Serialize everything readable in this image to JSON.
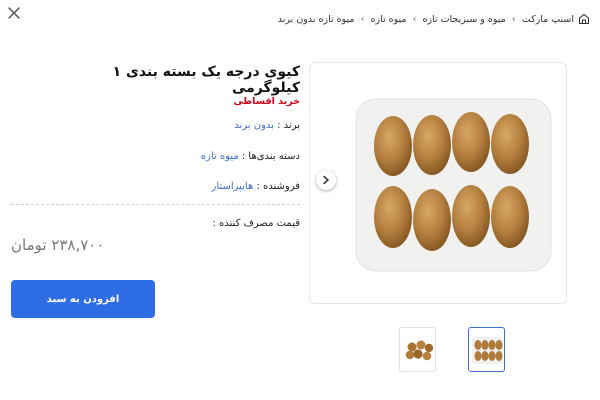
{
  "breadcrumb": [
    {
      "label": "اسنپ مارکت"
    },
    {
      "label": "میوه و سبزیجات تازه"
    },
    {
      "label": "میوه تازه"
    },
    {
      "label": "میوه تازه بدون برند"
    }
  ],
  "product": {
    "title": "کیوی درجه یک بسته بندی ۱ کیلوگرمی",
    "installment": "خرید اقساطی",
    "brand_label": "برند :",
    "brand_value": "بدون برند",
    "category_label": "دسته بندی‌ها :",
    "category_value": "میوه تازه",
    "seller_label": "فروشنده :",
    "seller_value": "هایپراستار",
    "price_label": "قیمت مصرف کننده :",
    "price": "۲۳۸,۷۰۰ تومان",
    "add_to_cart": "افزودن به سبد"
  },
  "colors": {
    "accent": "#2e6de6",
    "link": "#3d6fc9",
    "installment": "#d0021b",
    "price": "#777777"
  },
  "icons": {
    "close": "close-icon",
    "home": "store-icon",
    "breadcrumb_separator": "chevron-left-icon",
    "gallery_arrow": "chevron-right-icon"
  },
  "gallery": {
    "thumbnails": [
      {
        "name": "kiwi-tray-thumbnail",
        "selected": true
      },
      {
        "name": "kiwi-loose-thumbnail",
        "selected": false
      }
    ]
  }
}
